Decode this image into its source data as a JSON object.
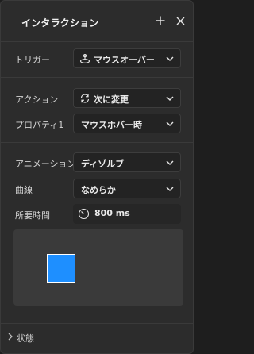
{
  "panel": {
    "title": "インタラクション",
    "add_icon": "plus-icon",
    "close_icon": "close-icon"
  },
  "trigger": {
    "label": "トリガー",
    "value": "マウスオーバー",
    "icon": "mouse-over-icon"
  },
  "action": {
    "label": "アクション",
    "value": "次に変更",
    "icon": "swap-icon"
  },
  "property": {
    "label": "プロパティ1",
    "value": "マウスホバー時"
  },
  "animation": {
    "label": "アニメーション",
    "value": "ディゾルブ"
  },
  "curve": {
    "label": "曲線",
    "value": "なめらか"
  },
  "duration": {
    "label": "所要時間",
    "value": "800 ms",
    "icon": "timer-icon"
  },
  "preview": {
    "square_color": "#1e8fff"
  },
  "footer": {
    "label": "状態",
    "icon": "chevron-right-icon"
  }
}
